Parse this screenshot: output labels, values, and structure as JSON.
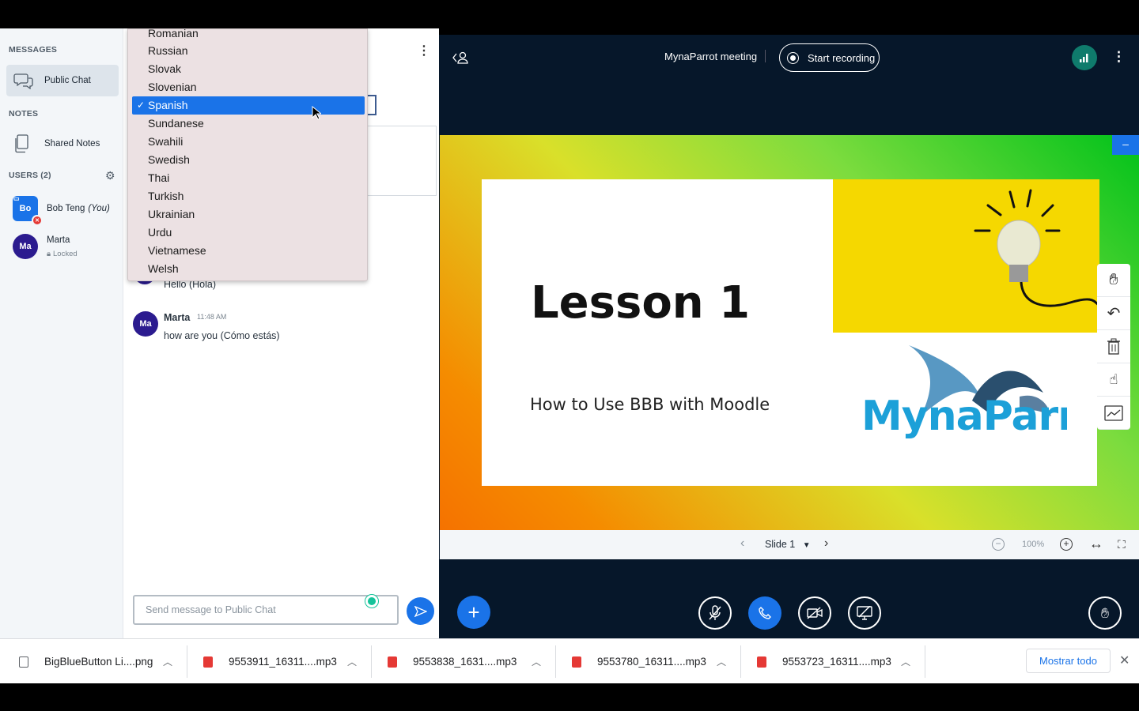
{
  "sidebar": {
    "messages_title": "MESSAGES",
    "public_chat_label": "Public Chat",
    "notes_title": "NOTES",
    "shared_notes_label": "Shared Notes",
    "users_title": "USERS (2)",
    "users": [
      {
        "initials": "Bo",
        "name": "Bob Teng",
        "suffix": "(You)",
        "avatar_color": "#1a73e8"
      },
      {
        "initials": "Ma",
        "name": "Marta",
        "status": "Locked",
        "avatar_color": "#2b1b8f"
      }
    ]
  },
  "chat": {
    "messages": [
      {
        "text": "Hello (Hola)"
      },
      {
        "initials": "Ma",
        "author": "Marta",
        "time": "11:48 AM",
        "text": "how are you (Cómo estás)"
      }
    ],
    "input_placeholder": "Send message to Public Chat"
  },
  "language_dropdown": {
    "options_before": [
      "Romanian",
      "Russian",
      "Slovak",
      "Slovenian"
    ],
    "selected": "Spanish",
    "options_after": [
      "Sundanese",
      "Swahili",
      "Swedish",
      "Thai",
      "Turkish",
      "Ukrainian",
      "Urdu",
      "Vietnamese",
      "Welsh"
    ]
  },
  "header": {
    "meeting_title": "MynaParrot meeting",
    "record_label": "Start recording"
  },
  "slide": {
    "title": "Lesson 1",
    "subtitle": "How to Use BBB with Moodle",
    "logo_text": "MynaParrot"
  },
  "slide_controls": {
    "slide_label": "Slide 1",
    "zoom": "100%"
  },
  "downloads": {
    "items": [
      {
        "name": "BigBlueButton Li....png",
        "type": "png"
      },
      {
        "name": "9553911_16311....mp3",
        "type": "mp3"
      },
      {
        "name": "9553838_1631....mp3",
        "type": "mp3"
      },
      {
        "name": "9553780_16311....mp3",
        "type": "mp3"
      },
      {
        "name": "9553723_16311....mp3",
        "type": "mp3"
      }
    ],
    "show_all_label": "Mostrar todo"
  },
  "colors": {
    "accent": "#1a73e8",
    "dark_bg": "#06172a",
    "slide_yellow": "#f5d800"
  }
}
